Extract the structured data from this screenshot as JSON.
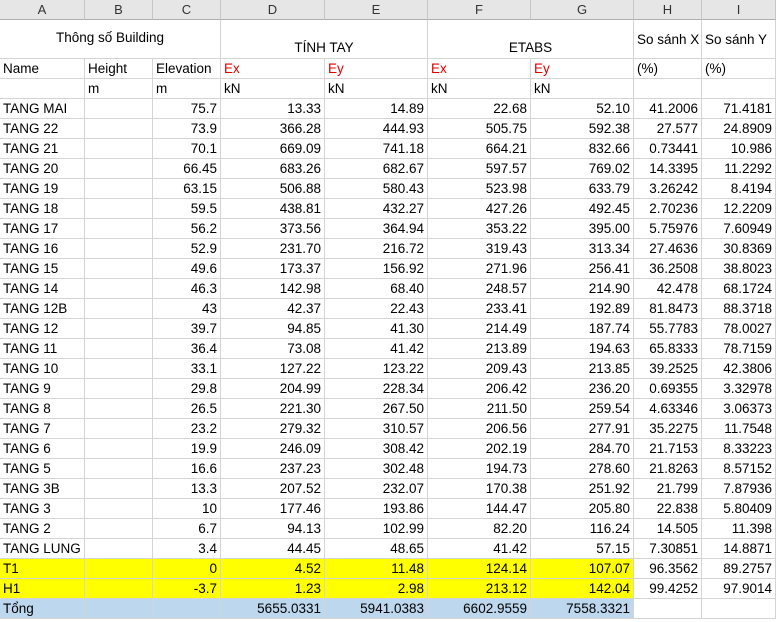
{
  "columns": [
    "A",
    "B",
    "C",
    "D",
    "E",
    "F",
    "G",
    "H",
    "I"
  ],
  "header": {
    "building_params": "Thông số Building",
    "tinh_tay": "TÍNH TAY",
    "etabs": "ETABS",
    "compare_x": "So sánh X",
    "compare_y": "So sánh Y",
    "name": "Name",
    "height": "Height",
    "elevation": "Elevation",
    "ex": "Ex",
    "ey": "Ey",
    "percent": "(%)",
    "unit_m": "m",
    "unit_kn": "kN"
  },
  "rows": [
    [
      "TANG MAI",
      "",
      "75.7",
      "13.33",
      "14.89",
      "22.68",
      "52.10",
      "41.2006",
      "71.4181"
    ],
    [
      "TANG 22",
      "",
      "73.9",
      "366.28",
      "444.93",
      "505.75",
      "592.38",
      "27.577",
      "24.8909"
    ],
    [
      "TANG 21",
      "",
      "70.1",
      "669.09",
      "741.18",
      "664.21",
      "832.66",
      "0.73441",
      "10.986"
    ],
    [
      "TANG 20",
      "",
      "66.45",
      "683.26",
      "682.67",
      "597.57",
      "769.02",
      "14.3395",
      "11.2292"
    ],
    [
      "TANG 19",
      "",
      "63.15",
      "506.88",
      "580.43",
      "523.98",
      "633.79",
      "3.26242",
      "8.4194"
    ],
    [
      "TANG 18",
      "",
      "59.5",
      "438.81",
      "432.27",
      "427.26",
      "492.45",
      "2.70236",
      "12.2209"
    ],
    [
      "TANG 17",
      "",
      "56.2",
      "373.56",
      "364.94",
      "353.22",
      "395.00",
      "5.75976",
      "7.60949"
    ],
    [
      "TANG 16",
      "",
      "52.9",
      "231.70",
      "216.72",
      "319.43",
      "313.34",
      "27.4636",
      "30.8369"
    ],
    [
      "TANG 15",
      "",
      "49.6",
      "173.37",
      "156.92",
      "271.96",
      "256.41",
      "36.2508",
      "38.8023"
    ],
    [
      "TANG 14",
      "",
      "46.3",
      "142.98",
      "68.40",
      "248.57",
      "214.90",
      "42.478",
      "68.1724"
    ],
    [
      "TANG 12B",
      "",
      "43",
      "42.37",
      "22.43",
      "233.41",
      "192.89",
      "81.8473",
      "88.3718"
    ],
    [
      "TANG 12",
      "",
      "39.7",
      "94.85",
      "41.30",
      "214.49",
      "187.74",
      "55.7783",
      "78.0027"
    ],
    [
      "TANG 11",
      "",
      "36.4",
      "73.08",
      "41.42",
      "213.89",
      "194.63",
      "65.8333",
      "78.7159"
    ],
    [
      "TANG 10",
      "",
      "33.1",
      "127.22",
      "123.22",
      "209.43",
      "213.85",
      "39.2525",
      "42.3806"
    ],
    [
      "TANG 9",
      "",
      "29.8",
      "204.99",
      "228.34",
      "206.42",
      "236.20",
      "0.69355",
      "3.32978"
    ],
    [
      "TANG 8",
      "",
      "26.5",
      "221.30",
      "267.50",
      "211.50",
      "259.54",
      "4.63346",
      "3.06373"
    ],
    [
      "TANG 7",
      "",
      "23.2",
      "279.32",
      "310.57",
      "206.56",
      "277.91",
      "35.2275",
      "11.7548"
    ],
    [
      "TANG 6",
      "",
      "19.9",
      "246.09",
      "308.42",
      "202.19",
      "284.70",
      "21.7153",
      "8.33223"
    ],
    [
      "TANG 5",
      "",
      "16.6",
      "237.23",
      "302.48",
      "194.73",
      "278.60",
      "21.8263",
      "8.57152"
    ],
    [
      "TANG 3B",
      "",
      "13.3",
      "207.52",
      "232.07",
      "170.38",
      "251.92",
      "21.799",
      "7.87936"
    ],
    [
      "TANG 3",
      "",
      "10",
      "177.46",
      "193.86",
      "144.47",
      "205.80",
      "22.838",
      "5.80409"
    ],
    [
      "TANG 2",
      "",
      "6.7",
      "94.13",
      "102.99",
      "82.20",
      "116.24",
      "14.505",
      "11.398"
    ],
    [
      "TANG LUNG",
      "",
      "3.4",
      "44.45",
      "48.65",
      "41.42",
      "57.15",
      "7.30851",
      "14.8871"
    ]
  ],
  "highlight_rows": [
    [
      "T1",
      "",
      "0",
      "4.52",
      "11.48",
      "124.14",
      "107.07",
      "96.3562",
      "89.2757"
    ],
    [
      "H1",
      "",
      "-3.7",
      "1.23",
      "2.98",
      "213.12",
      "142.04",
      "99.4252",
      "97.9014"
    ]
  ],
  "total_row": [
    "Tổng",
    "",
    "",
    "5655.0331",
    "5941.0383",
    "6602.9559",
    "7558.3321",
    "",
    ""
  ],
  "colors": {
    "header_bg": "#e6e6e6",
    "highlight": "#ffff00",
    "total": "#bdd7ee",
    "red_text": "#e00000"
  }
}
